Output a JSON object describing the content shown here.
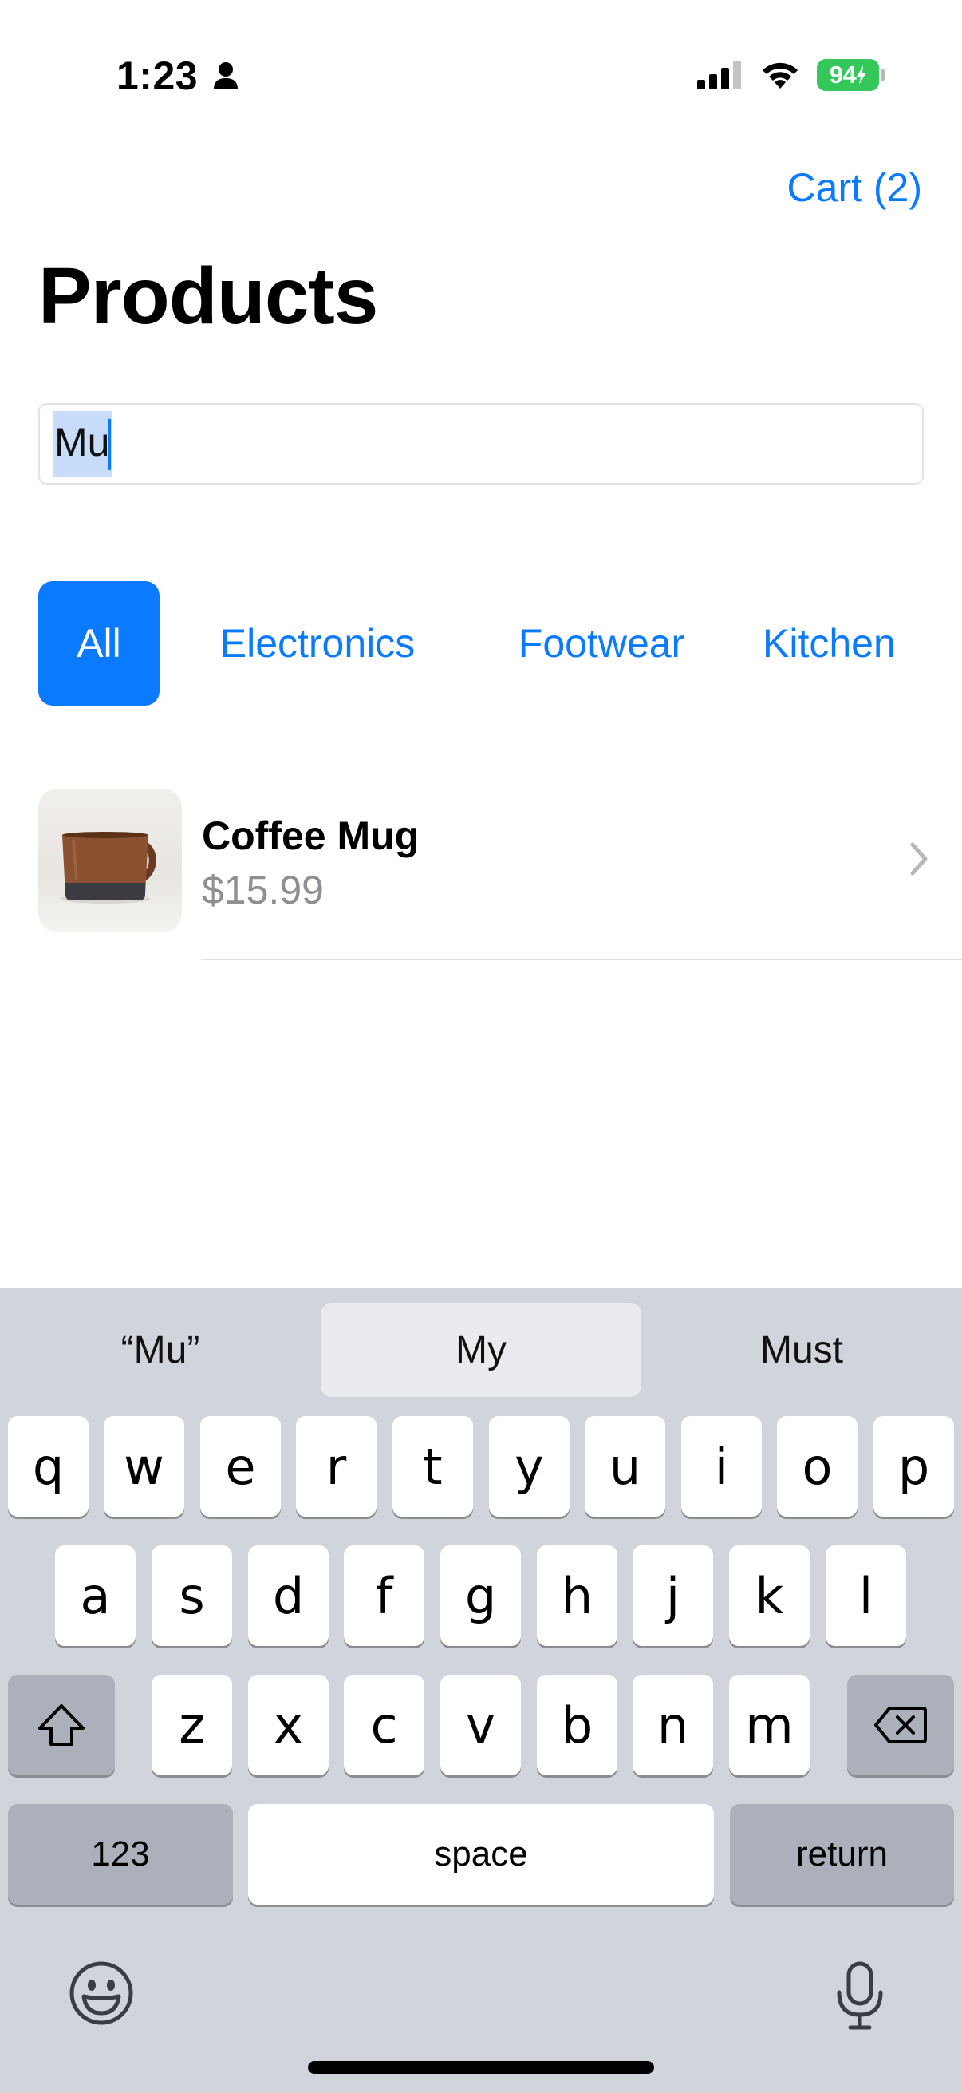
{
  "status_bar": {
    "time": "1:23",
    "battery": "94",
    "battery_color": "#34c759"
  },
  "header": {
    "cart_label": "Cart (2)",
    "title": "Products"
  },
  "search": {
    "value": "Mu",
    "icon": "none"
  },
  "categories": {
    "items": [
      "All",
      "Electronics",
      "Footwear",
      "Kitchen"
    ],
    "selected": "All",
    "accent": "#0a7bff"
  },
  "products": [
    {
      "name": "Coffee Mug",
      "price": "$15.99",
      "image": "coffee-mug-image"
    }
  ],
  "keyboard": {
    "suggestions": [
      "“Mu”",
      "My",
      "Must"
    ],
    "row1": [
      "q",
      "w",
      "e",
      "r",
      "t",
      "y",
      "u",
      "i",
      "o",
      "p"
    ],
    "row2": [
      "a",
      "s",
      "d",
      "f",
      "g",
      "h",
      "j",
      "k",
      "l"
    ],
    "row3": [
      "z",
      "x",
      "c",
      "v",
      "b",
      "n",
      "m"
    ],
    "numbers_label": "123",
    "space_label": "space",
    "return_label": "return"
  }
}
